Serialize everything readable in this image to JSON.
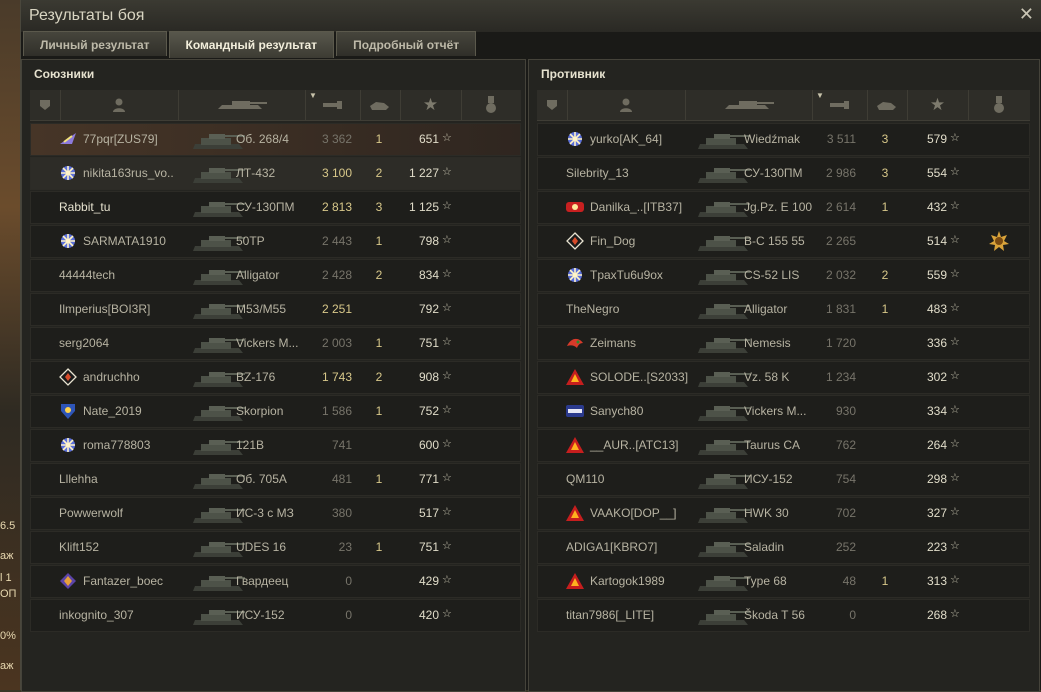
{
  "window": {
    "title": "Результаты боя"
  },
  "tabs": [
    {
      "label": "Личный результат"
    },
    {
      "label": "Командный результат"
    },
    {
      "label": "Подробный отчёт"
    }
  ],
  "colors": {
    "accent": "#d8c88a",
    "panel": "#242420",
    "me_row": "#463527"
  },
  "allies": {
    "title": "Союзники",
    "players": [
      {
        "name": "77pqr[ZUS79]",
        "tank": "Об. 268/4",
        "damage": "3 362",
        "kills": "1",
        "xp": "651",
        "clan_icon": "plane-emblem",
        "dmg_hi": false
      },
      {
        "name": "nikita163rus_vo..",
        "tank": "ЛТ-432",
        "damage": "3 100",
        "kills": "2",
        "xp": "1 227",
        "clan_icon": "snowflake-emblem",
        "dmg_hi": true
      },
      {
        "name": "Rabbit_tu",
        "tank": "СУ-130ПМ",
        "damage": "2 813",
        "kills": "3",
        "xp": "1 125",
        "clan_icon": "",
        "dmg_hi": true
      },
      {
        "name": "SARMATA1910",
        "tank": "50TP",
        "damage": "2 443",
        "kills": "1",
        "xp": "798",
        "clan_icon": "snowflake-emblem",
        "dmg_hi": false
      },
      {
        "name": "44444tech",
        "tank": "Alligator",
        "damage": "2 428",
        "kills": "2",
        "xp": "834",
        "clan_icon": "",
        "dmg_hi": false
      },
      {
        "name": "Ilmperius[BOI3R]",
        "tank": "M53/M55",
        "damage": "2 251",
        "kills": "",
        "xp": "792",
        "clan_icon": "",
        "dmg_hi": true
      },
      {
        "name": "serg2064",
        "tank": "Vickers M...",
        "damage": "2 003",
        "kills": "1",
        "xp": "751",
        "clan_icon": "",
        "dmg_hi": false
      },
      {
        "name": "andruchho",
        "tank": "BZ-176",
        "damage": "1 743",
        "kills": "2",
        "xp": "908",
        "clan_icon": "diamond-emblem",
        "dmg_hi": true
      },
      {
        "name": "Nate_2019",
        "tank": "Skorpion",
        "damage": "1 586",
        "kills": "1",
        "xp": "752",
        "clan_icon": "shield-emblem",
        "dmg_hi": false
      },
      {
        "name": "roma778803",
        "tank": "121B",
        "damage": "741",
        "kills": "",
        "xp": "600",
        "clan_icon": "snowflake-emblem",
        "dmg_hi": false
      },
      {
        "name": "Lllehha",
        "tank": "Об. 705А",
        "damage": "481",
        "kills": "1",
        "xp": "771",
        "clan_icon": "",
        "dmg_hi": false
      },
      {
        "name": "Powwerwolf",
        "tank": "ИС-3 с МЗ",
        "damage": "380",
        "kills": "",
        "xp": "517",
        "clan_icon": "",
        "dmg_hi": false
      },
      {
        "name": "Klift152",
        "tank": "UDES 16",
        "damage": "23",
        "kills": "1",
        "xp": "751",
        "clan_icon": "",
        "dmg_hi": false
      },
      {
        "name": "Fantazer_boec",
        "tank": "Гвардеец",
        "damage": "0",
        "kills": "",
        "xp": "429",
        "clan_icon": "crest-emblem",
        "dmg_hi": false
      },
      {
        "name": "inkognito_307",
        "tank": "ИСУ-152",
        "damage": "0",
        "kills": "",
        "xp": "420",
        "clan_icon": "",
        "dmg_hi": false
      }
    ]
  },
  "enemies": {
    "title": "Противник",
    "players": [
      {
        "name": "yurko[AK_64]",
        "tank": "Wiedźmak",
        "damage": "3 511",
        "kills": "3",
        "xp": "579",
        "clan_icon": "snowflake-emblem",
        "dmg_hi": false
      },
      {
        "name": "Silebrity_13",
        "tank": "СУ-130ПМ",
        "damage": "2 986",
        "kills": "3",
        "xp": "554",
        "clan_icon": "",
        "dmg_hi": false
      },
      {
        "name": "Danilka_..[ITB37]",
        "tank": "Jg.Pz. E 100",
        "damage": "2 614",
        "kills": "1",
        "xp": "432",
        "clan_icon": "red-badge-emblem",
        "dmg_hi": false
      },
      {
        "name": "Fin_Dog",
        "tank": "B-C 155 55",
        "damage": "2 265",
        "kills": "",
        "xp": "514",
        "clan_icon": "diamond-emblem",
        "medal": "sun-medal",
        "dmg_hi": false
      },
      {
        "name": "TpaxTu6u9ox",
        "tank": "CS-52 LIS",
        "damage": "2 032",
        "kills": "2",
        "xp": "559",
        "clan_icon": "snowflake-emblem",
        "dmg_hi": false
      },
      {
        "name": "TheNegro",
        "tank": "Alligator",
        "damage": "1 831",
        "kills": "1",
        "xp": "483",
        "clan_icon": "",
        "dmg_hi": false
      },
      {
        "name": "Zeimans",
        "tank": "Nemesis",
        "damage": "1 720",
        "kills": "",
        "xp": "336",
        "clan_icon": "dragon-emblem",
        "dmg_hi": false
      },
      {
        "name": "SOLODE..[S2033]",
        "tank": "Vz. 58 K",
        "damage": "1 234",
        "kills": "",
        "xp": "302",
        "clan_icon": "triangle-emblem",
        "dmg_hi": false
      },
      {
        "name": "Sanych80",
        "tank": "Vickers M...",
        "damage": "930",
        "kills": "",
        "xp": "334",
        "clan_icon": "yusha-emblem",
        "dmg_hi": false
      },
      {
        "name": "__AUR..[ATC13]",
        "tank": "Taurus CA",
        "damage": "762",
        "kills": "",
        "xp": "264",
        "clan_icon": "triangle-emblem",
        "dmg_hi": false
      },
      {
        "name": "QM110",
        "tank": "ИСУ-152",
        "damage": "754",
        "kills": "",
        "xp": "298",
        "clan_icon": "",
        "dmg_hi": false
      },
      {
        "name": "VAAKO[DOP__]",
        "tank": "HWK 30",
        "damage": "702",
        "kills": "",
        "xp": "327",
        "clan_icon": "triangle-emblem",
        "dmg_hi": false
      },
      {
        "name": "ADIGA1[KBRO7]",
        "tank": "Saladin",
        "damage": "252",
        "kills": "",
        "xp": "223",
        "clan_icon": "",
        "dmg_hi": false
      },
      {
        "name": "Kartogok1989",
        "tank": "Type 68",
        "damage": "48",
        "kills": "1",
        "xp": "313",
        "clan_icon": "triangle-emblem",
        "dmg_hi": false
      },
      {
        "name": "titan7986[_LITE]",
        "tank": "Škoda T 56",
        "damage": "0",
        "kills": "",
        "xp": "268",
        "clan_icon": "",
        "dmg_hi": false
      }
    ]
  },
  "background_text": [
    "6.5",
    "аж",
    "l 1",
    "ОП",
    "0%",
    "аж"
  ]
}
